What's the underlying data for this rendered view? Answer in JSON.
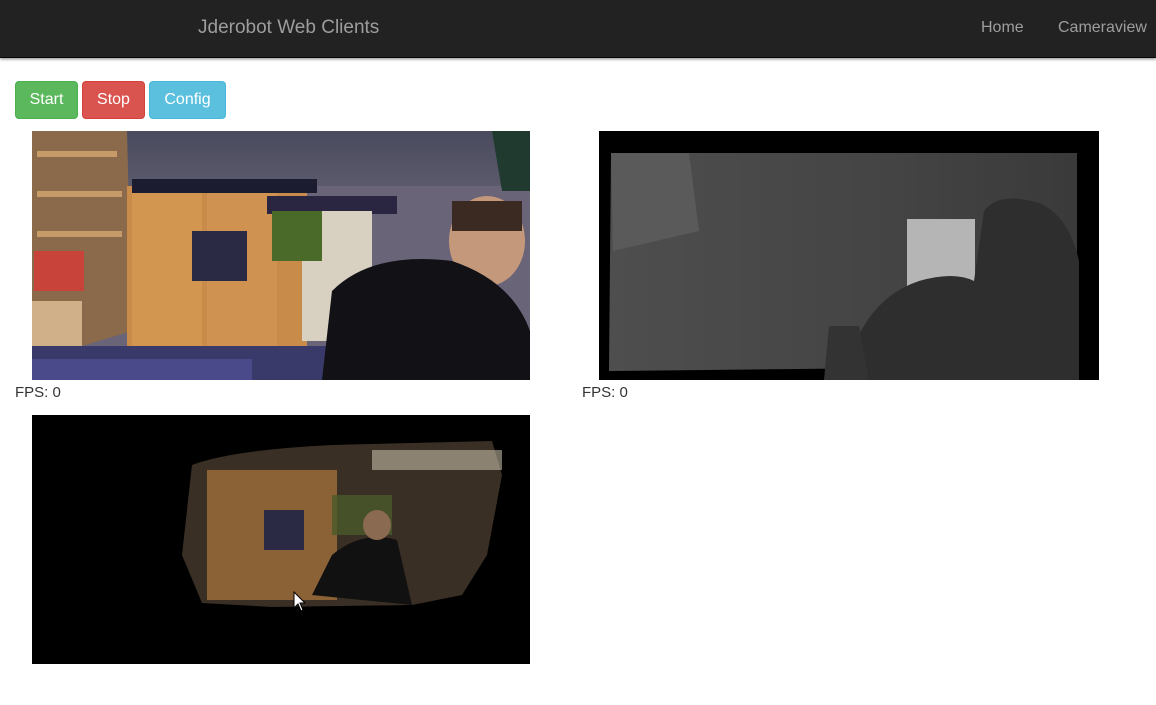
{
  "navbar": {
    "brand": "Jderobot Web Clients",
    "links": [
      {
        "label": "Home"
      },
      {
        "label": "Cameraview"
      }
    ]
  },
  "controls": {
    "start_label": "Start",
    "stop_label": "Stop",
    "config_label": "Config"
  },
  "colors": {
    "navbar_bg": "#222222",
    "nav_text": "#9d9d9d",
    "start": "#5cb85c",
    "stop": "#d9534f",
    "config": "#5bc0de"
  },
  "views": [
    {
      "fps_text": "FPS: 0"
    },
    {
      "fps_text": "FPS: 0"
    }
  ]
}
